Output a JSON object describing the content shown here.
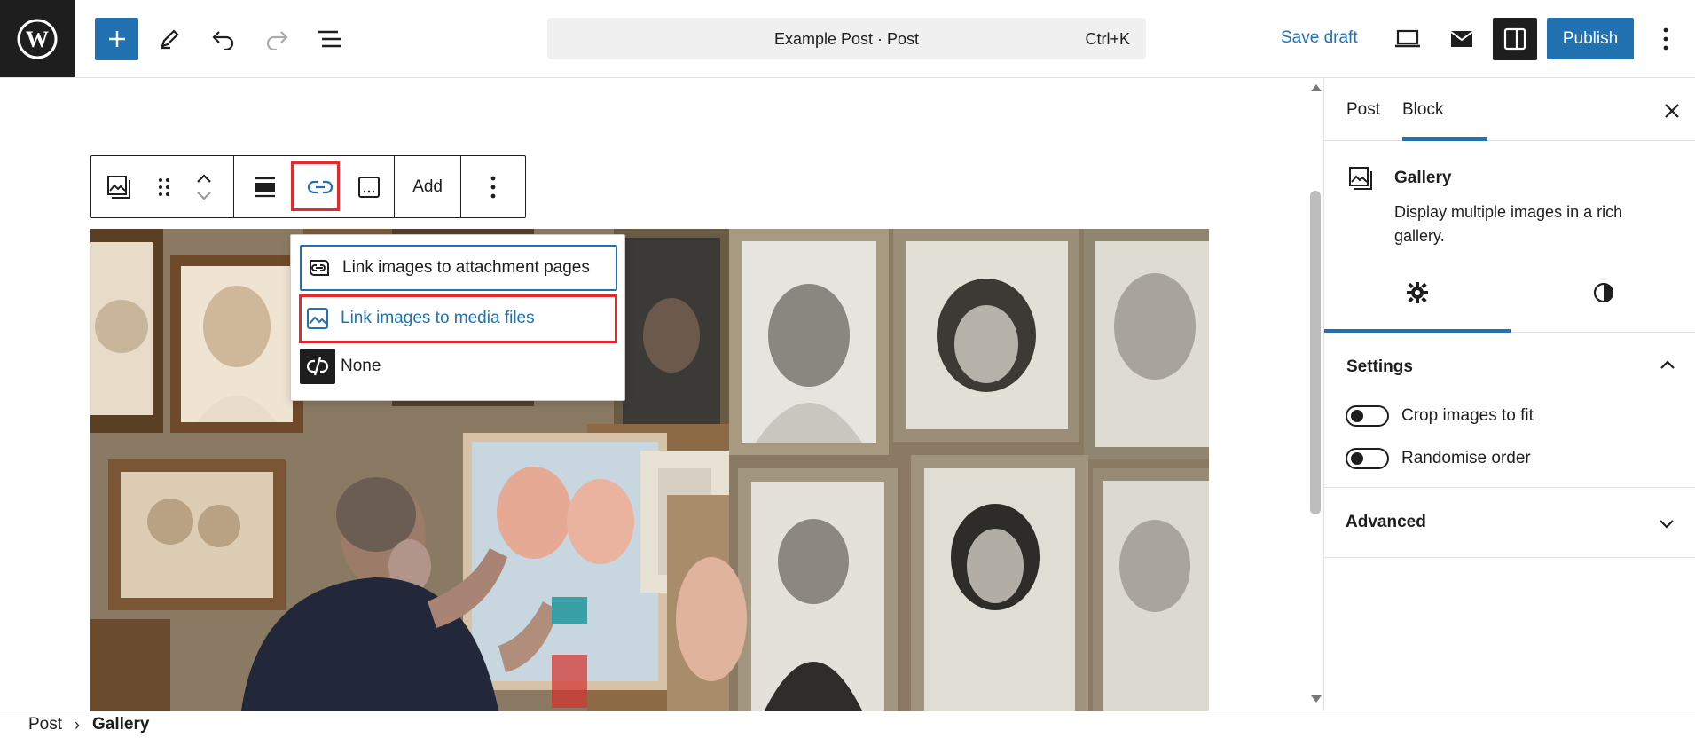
{
  "topbar": {
    "document_title": "Example Post · Post",
    "shortcut": "Ctrl+K",
    "save_draft": "Save draft",
    "publish": "Publish"
  },
  "block_toolbar": {
    "add_label": "Add"
  },
  "link_menu": {
    "items": [
      {
        "label": "Link images to attachment pages",
        "icon": "attachment-link-icon",
        "state": "focused"
      },
      {
        "label": "Link images to media files",
        "icon": "image-icon",
        "state": "hover"
      },
      {
        "label": "None",
        "icon": "link-off-icon",
        "state": "default"
      }
    ]
  },
  "breadcrumb": {
    "items": [
      "Post",
      "Gallery"
    ]
  },
  "sidebar": {
    "tabs": [
      "Post",
      "Block"
    ],
    "active_tab": "Block",
    "block": {
      "name": "Gallery",
      "description": "Display multiple images in a rich gallery."
    },
    "panels": {
      "settings": {
        "title": "Settings",
        "toggles": [
          {
            "label": "Crop images to fit",
            "checked": false
          },
          {
            "label": "Randomise order",
            "checked": false
          }
        ]
      },
      "advanced": {
        "title": "Advanced"
      }
    }
  },
  "colors": {
    "accent": "#2271b1",
    "highlight": "#e32a2e",
    "dark": "#1e1e1e"
  }
}
